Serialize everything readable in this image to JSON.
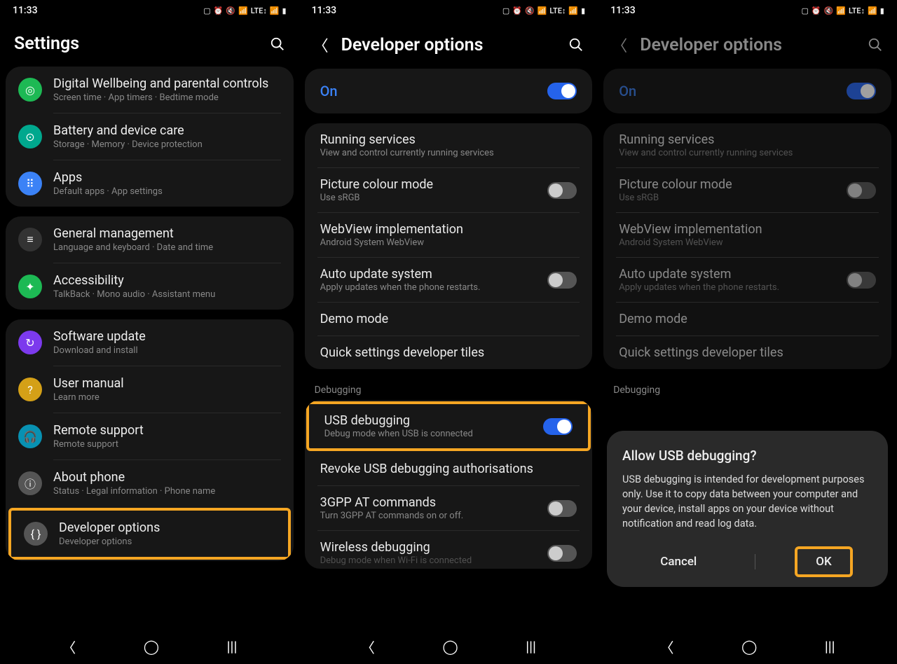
{
  "status": {
    "time": "11:33"
  },
  "phone1": {
    "headerTitle": "Settings",
    "items": [
      {
        "title": "Digital Wellbeing and parental controls",
        "sub": "Screen time  ·  App timers  ·  Bedtime mode",
        "iconBg": "icon-circle-green"
      },
      {
        "title": "Battery and device care",
        "sub": "Storage  ·  Memory  ·  Device protection",
        "iconBg": "icon-circle-teal"
      },
      {
        "title": "Apps",
        "sub": "Default apps  ·  App settings",
        "iconBg": "icon-circle-blue"
      }
    ],
    "items2": [
      {
        "title": "General management",
        "sub": "Language and keyboard  ·  Date and time",
        "iconBg": "icon-circle-grey"
      },
      {
        "title": "Accessibility",
        "sub": "TalkBack  ·  Mono audio  ·  Assistant menu",
        "iconBg": "icon-circle-green"
      }
    ],
    "items3": [
      {
        "title": "Software update",
        "sub": "Download and install",
        "iconBg": "icon-circle-violet"
      },
      {
        "title": "User manual",
        "sub": "Learn more",
        "iconBg": "icon-circle-yellow"
      },
      {
        "title": "Remote support",
        "sub": "Remote support",
        "iconBg": "icon-circle-cyan"
      },
      {
        "title": "About phone",
        "sub": "Status  ·  Legal information  ·  Phone name",
        "iconBg": "icon-circle-dgrey"
      },
      {
        "title": "Developer options",
        "sub": "Developer options",
        "iconBg": "icon-circle-dgrey"
      }
    ]
  },
  "phone2": {
    "headerTitle": "Developer options",
    "onLabel": "On",
    "items": [
      {
        "title": "Running services",
        "sub": "View and control currently running services"
      },
      {
        "title": "Picture colour mode",
        "sub": "Use sRGB",
        "toggle": "off"
      },
      {
        "title": "WebView implementation",
        "sub": "Android System WebView"
      },
      {
        "title": "Auto update system",
        "sub": "Apply updates when the phone restarts.",
        "toggle": "off"
      },
      {
        "title": "Demo mode"
      },
      {
        "title": "Quick settings developer tiles"
      }
    ],
    "debugLabel": "Debugging",
    "debugItems": [
      {
        "title": "USB debugging",
        "sub": "Debug mode when USB is connected",
        "toggle": "on",
        "highlight": true
      },
      {
        "title": "Revoke USB debugging authorisations"
      },
      {
        "title": "3GPP AT commands",
        "sub": "Turn 3GPP AT commands on or off.",
        "toggle": "off"
      },
      {
        "title": "Wireless debugging",
        "sub": "Debug mode when Wi-Fi is connected",
        "toggle": "off"
      }
    ]
  },
  "phone3": {
    "headerTitle": "Developer options",
    "onLabel": "On",
    "dialog": {
      "title": "Allow USB debugging?",
      "body": "USB debugging is intended for development purposes only. Use it to copy data between your computer and your device, install apps on your device without notification and read log data.",
      "cancel": "Cancel",
      "ok": "OK"
    }
  }
}
